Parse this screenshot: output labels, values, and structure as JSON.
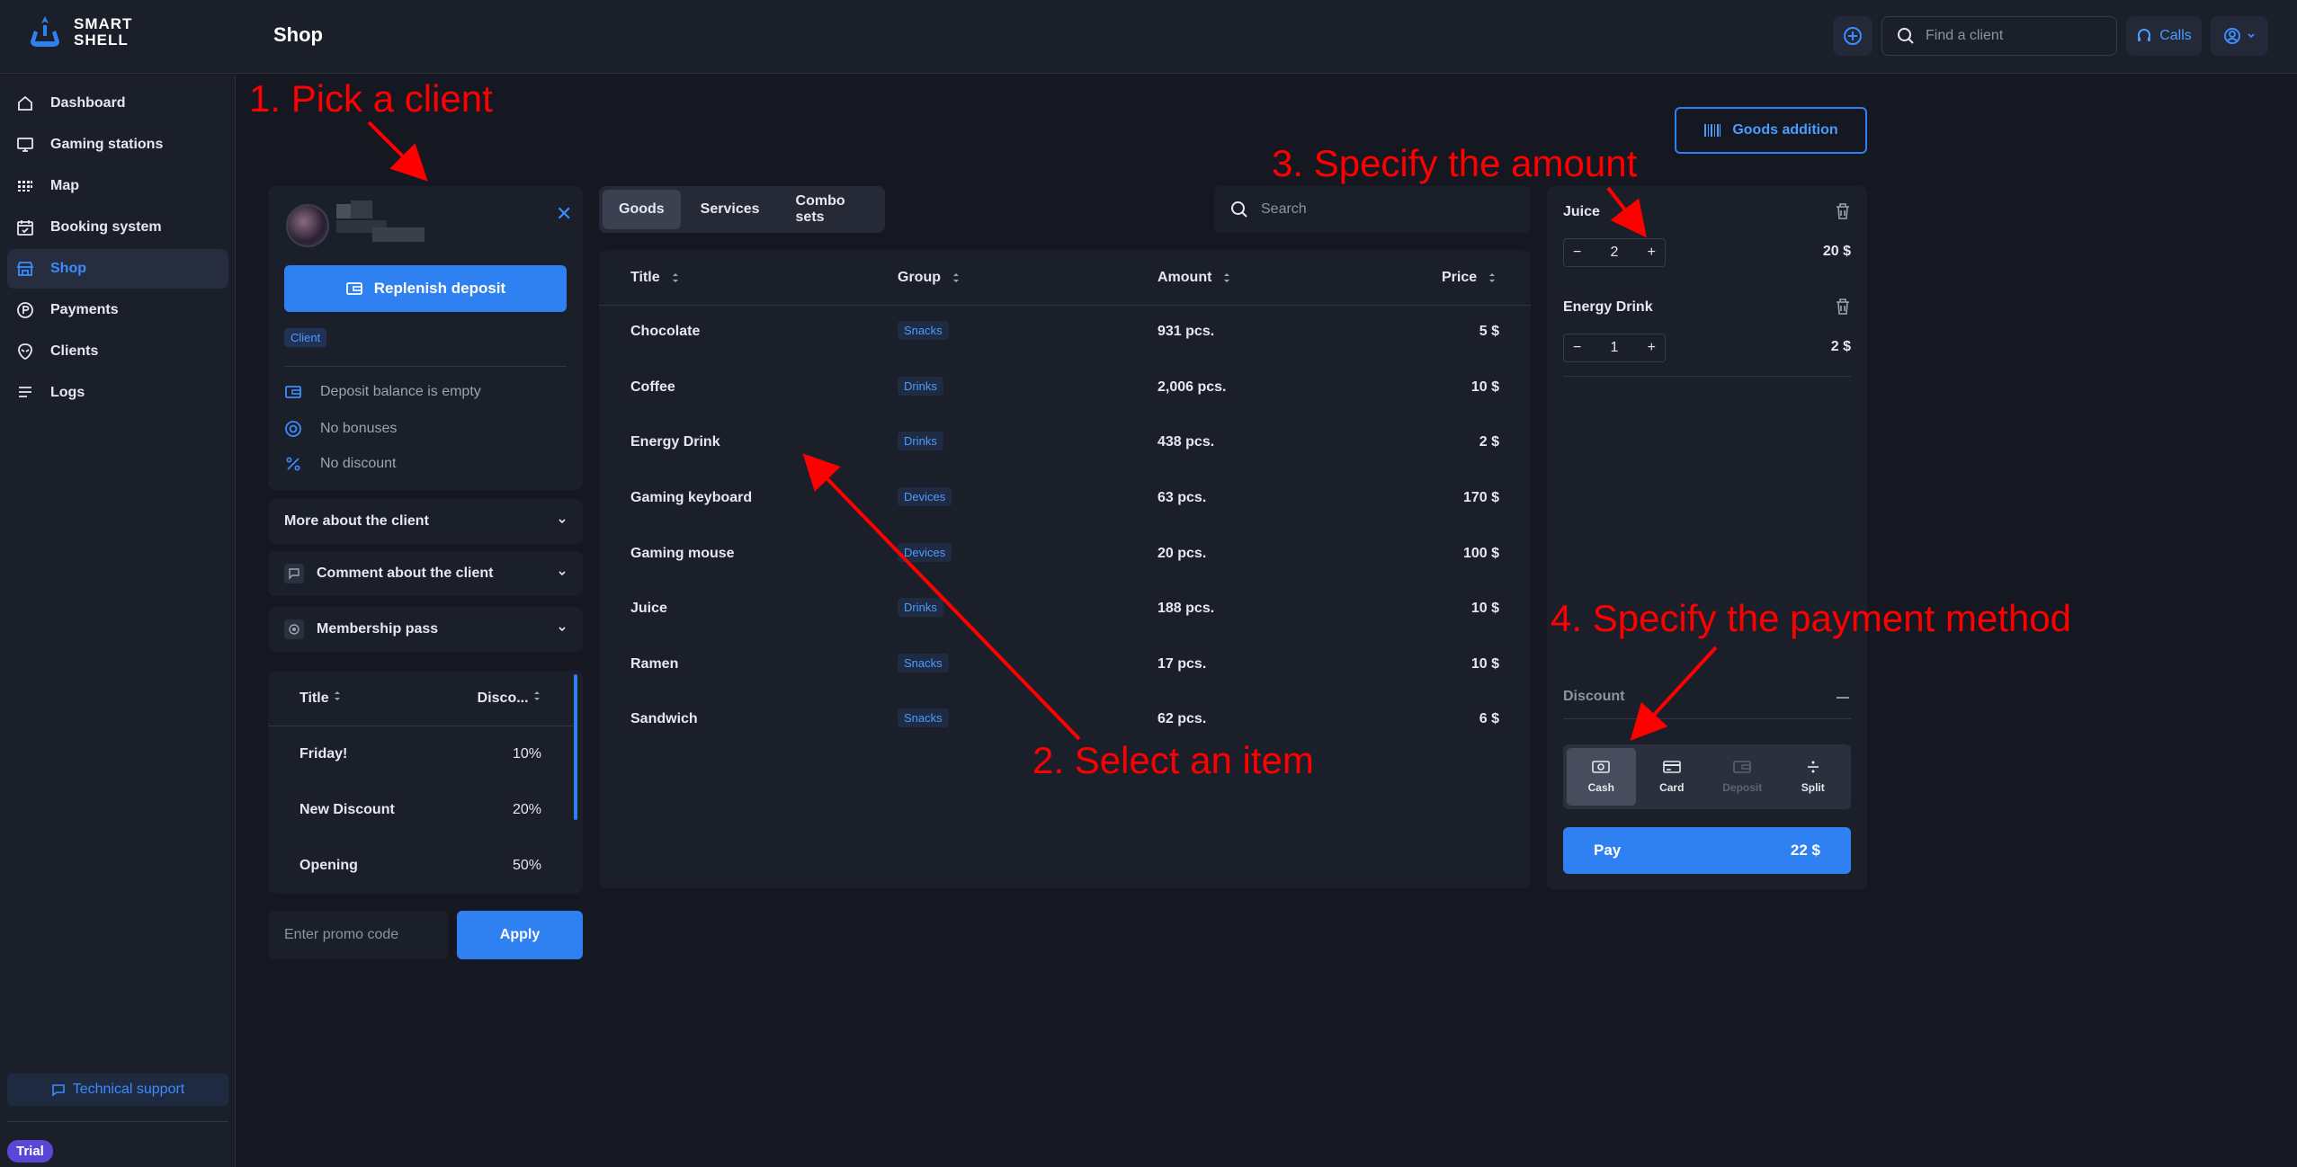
{
  "brand": {
    "line1": "SMART",
    "line2": "SHELL"
  },
  "header": {
    "title": "Shop",
    "find_client_placeholder": "Find a client",
    "calls_label": "Calls"
  },
  "sidebar": {
    "items": [
      {
        "label": "Dashboard",
        "icon": "home-icon"
      },
      {
        "label": "Gaming stations",
        "icon": "monitor-icon"
      },
      {
        "label": "Map",
        "icon": "grid-icon"
      },
      {
        "label": "Booking system",
        "icon": "calendar-icon"
      },
      {
        "label": "Shop",
        "icon": "store-icon",
        "active": true
      },
      {
        "label": "Payments",
        "icon": "payments-icon"
      },
      {
        "label": "Clients",
        "icon": "alien-icon"
      },
      {
        "label": "Logs",
        "icon": "list-icon"
      }
    ],
    "support_label": "Technical support",
    "trial_label": "Trial"
  },
  "client": {
    "replenish_label": "Replenish deposit",
    "badge": "Client",
    "deposit_text": "Deposit balance is empty",
    "bonuses_text": "No bonuses",
    "discount_text": "No discount",
    "more_about": "More about the client",
    "comment": "Comment about the client",
    "membership": "Membership pass"
  },
  "discounts": {
    "headers": [
      "Title",
      "Disco..."
    ],
    "rows": [
      {
        "title": "Friday!",
        "pct": "10%"
      },
      {
        "title": "New Discount",
        "pct": "20%"
      },
      {
        "title": "Opening",
        "pct": "50%"
      }
    ]
  },
  "promo": {
    "placeholder": "Enter promo code",
    "apply_label": "Apply"
  },
  "goods": {
    "tabs": [
      "Goods",
      "Services",
      "Combo sets"
    ],
    "active_tab": "Goods",
    "search_placeholder": "Search",
    "headers": [
      "Title",
      "Group",
      "Amount",
      "Price"
    ],
    "rows": [
      {
        "title": "Chocolate",
        "group": "Snacks",
        "amount": "931 pcs.",
        "price": "5 $"
      },
      {
        "title": "Coffee",
        "group": "Drinks",
        "amount": "2,006 pcs.",
        "price": "10 $"
      },
      {
        "title": "Energy Drink",
        "group": "Drinks",
        "amount": "438 pcs.",
        "price": "2 $"
      },
      {
        "title": "Gaming keyboard",
        "group": "Devices",
        "amount": "63 pcs.",
        "price": "170 $"
      },
      {
        "title": "Gaming mouse",
        "group": "Devices",
        "amount": "20 pcs.",
        "price": "100 $"
      },
      {
        "title": "Juice",
        "group": "Drinks",
        "amount": "188 pcs.",
        "price": "10 $"
      },
      {
        "title": "Ramen",
        "group": "Snacks",
        "amount": "17 pcs.",
        "price": "10 $"
      },
      {
        "title": "Sandwich",
        "group": "Snacks",
        "amount": "62 pcs.",
        "price": "6 $"
      }
    ],
    "addition_label": "Goods addition"
  },
  "cart": {
    "items": [
      {
        "name": "Juice",
        "qty": "2",
        "price": "20 $"
      },
      {
        "name": "Energy Drink",
        "qty": "1",
        "price": "2 $"
      }
    ],
    "discount_label": "Discount",
    "payment_methods": [
      {
        "label": "Cash",
        "state": "active"
      },
      {
        "label": "Card",
        "state": "normal"
      },
      {
        "label": "Deposit",
        "state": "disabled"
      },
      {
        "label": "Split",
        "state": "normal"
      }
    ],
    "pay_label": "Pay",
    "pay_amount": "22 $"
  },
  "annotations": {
    "step1": "1. Pick a client",
    "step2": "2. Select an item",
    "step3": "3. Specify the amount",
    "step4": "4. Specify the payment method",
    "color": "#ff0000"
  },
  "colors": {
    "accent": "#2f80f0",
    "background": "#151820",
    "panel": "#1b1f29"
  }
}
